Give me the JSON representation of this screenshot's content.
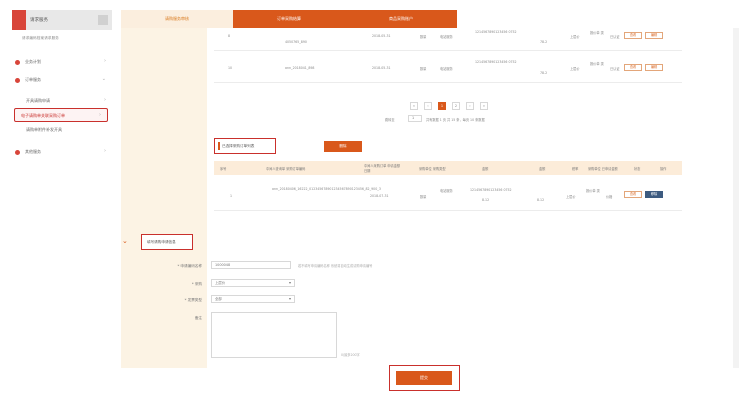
{
  "sidebar": {
    "title": "请求服务",
    "subtitle": "请求编码档案请求服务",
    "items": [
      {
        "label": "业务计划"
      },
      {
        "label": "订单服务"
      },
      {
        "label": "开具请购申请"
      },
      {
        "label": "电子请购单关联采购订单"
      },
      {
        "label": "请购单附件补发开具"
      },
      {
        "label": "其他服务"
      }
    ]
  },
  "tabs": [
    {
      "label": "请购服务审核"
    },
    {
      "label": "订单采购结算"
    },
    {
      "label": "商品采购账户"
    }
  ],
  "upper_table": {
    "rows": [
      {
        "idx": "8",
        "name": "4050765_890",
        "date": "2018-05-31",
        "qty": "数量",
        "dept": "电站服务",
        "code": "1214567890123456 0752",
        "amount": "78.2",
        "unit": "上层价",
        "type": "报价单 类",
        "price": "价格",
        "status": "已认证"
      },
      {
        "idx": "10",
        "name": "ann_2018041_898",
        "date": "2018-05-31",
        "qty": "数量",
        "dept": "电站服务",
        "code": "1214567890123456 0752",
        "amount": "78.2",
        "unit": "上层价",
        "type": "报价单 类",
        "price": "价格",
        "status": "已认证"
      }
    ],
    "action_view": "查看",
    "action_edit": "编辑"
  },
  "pager": {
    "buttons": [
      "«",
      "‹",
      "1",
      "2",
      "›",
      "»"
    ],
    "jump_label": "跳转至",
    "page_input": "1",
    "summary": "共有数据 1 页 共 15 条，每页 10 条数据"
  },
  "selected_section": {
    "title": "已选择采购订单列表",
    "delete_button": "删除"
  },
  "lower_table": {
    "headers": [
      "序号",
      "中间人查询单 采购订单编码",
      "中间人采购订单 申请金额 日期",
      "采购单位 采购类型",
      "金额",
      "金额",
      "税率",
      "采购单位 已申请金额",
      "状态",
      "操作"
    ],
    "row": {
      "idx": "1",
      "name": "ann_20180406_16222_012345678901234567890123456_82_900_3",
      "date": "2018-07-31",
      "qty": "数量",
      "dept": "电站服务",
      "code": "1214567890123456 0752",
      "amount": "8.12",
      "amount2": "8.12",
      "unit": "上层价",
      "type": "报价单 类",
      "price": "价格",
      "view": "查看",
      "remove": "移除"
    }
  },
  "form_section": {
    "title": "填写请购申请信息",
    "fields": [
      {
        "label": "* 申请编码名称",
        "value": "1000048",
        "hint": "若不填写申请编码名称 系统将自动生成请购申请编号"
      },
      {
        "label": "* 采购",
        "value": "上层价"
      },
      {
        "label": "* 发票类型",
        "value": "全部"
      },
      {
        "label": "备注",
        "value": "",
        "counter": "0/最多200字"
      }
    ]
  },
  "submit_button": "提交",
  "colors": {
    "accent": "#d9581b",
    "highlight": "#c9302c",
    "beige": "#fcf3e4"
  }
}
